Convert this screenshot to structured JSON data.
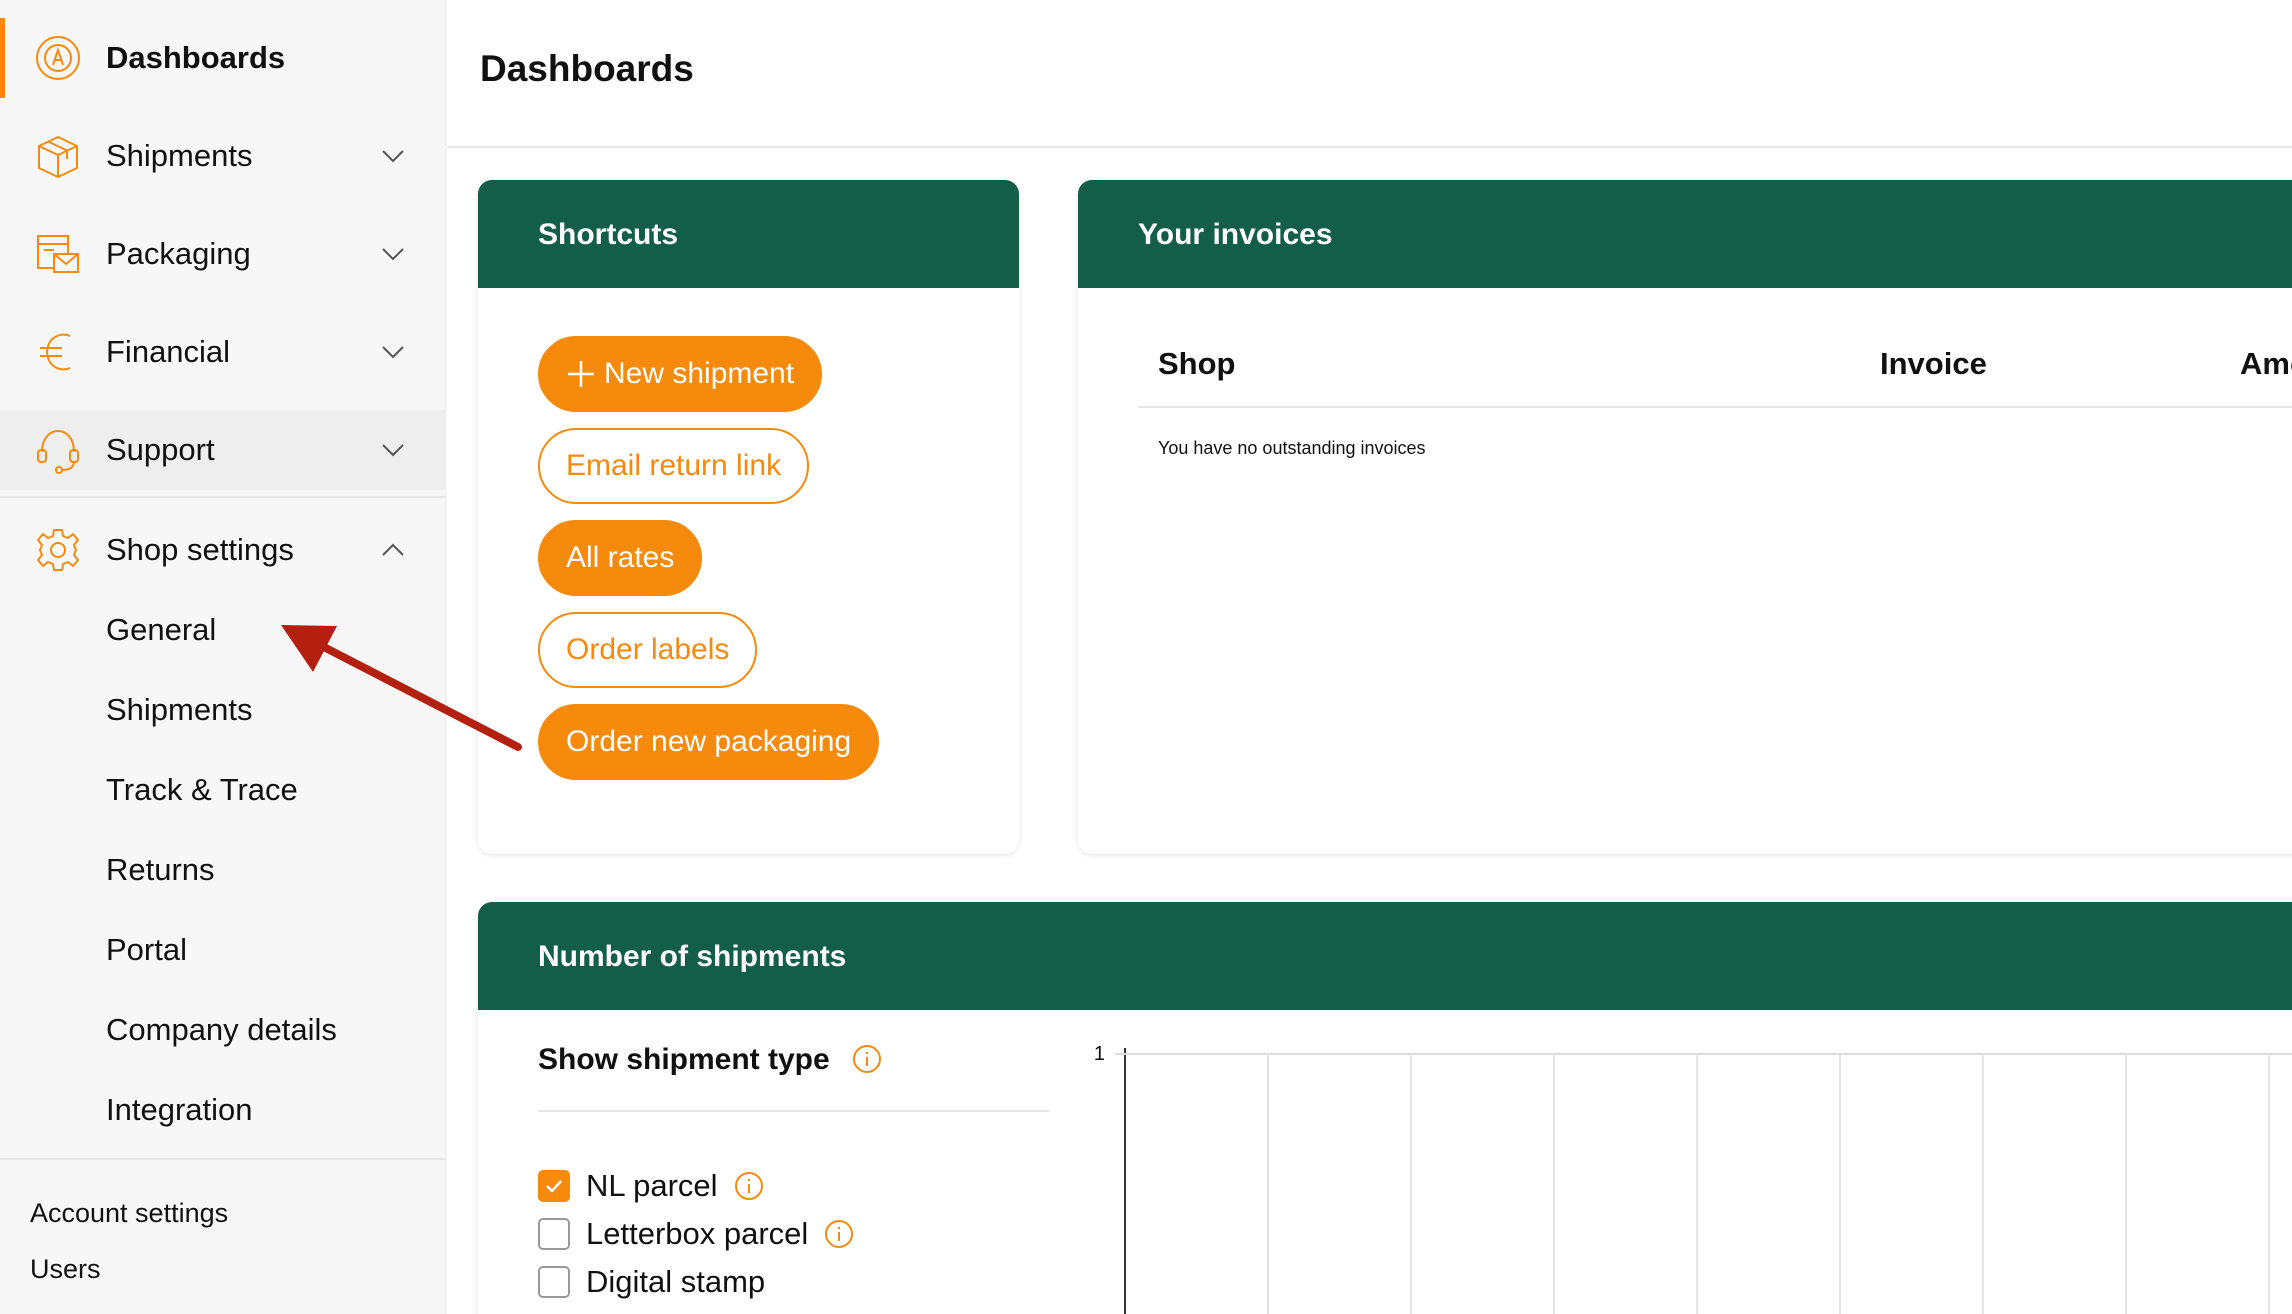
{
  "colors": {
    "accent": "#f68a0d",
    "card_header": "#135e49",
    "sidebar_bg": "#f7f7f7",
    "annotation_arrow": "#b32010"
  },
  "sidebar": {
    "items": [
      {
        "label": "Dashboards",
        "icon": "dashboard-icon",
        "active": true
      },
      {
        "label": "Shipments",
        "icon": "box-icon",
        "expandable": true
      },
      {
        "label": "Packaging",
        "icon": "packaging-icon",
        "expandable": true
      },
      {
        "label": "Financial",
        "icon": "euro-icon",
        "expandable": true
      },
      {
        "label": "Support",
        "icon": "headset-icon",
        "expandable": true
      },
      {
        "label": "Shop settings",
        "icon": "gear-icon",
        "expanded": true
      }
    ],
    "shop_settings_children": [
      "General",
      "Shipments",
      "Track & Trace",
      "Returns",
      "Portal",
      "Company details",
      "Integration"
    ],
    "bottom_links": [
      "Account settings",
      "Users"
    ]
  },
  "header": {
    "title": "Dashboards"
  },
  "shortcuts": {
    "title": "Shortcuts",
    "buttons": [
      {
        "label": "New shipment",
        "style": "filled",
        "icon": "plus-icon"
      },
      {
        "label": "Email return link",
        "style": "outline"
      },
      {
        "label": "All rates",
        "style": "filled"
      },
      {
        "label": "Order labels",
        "style": "outline"
      },
      {
        "label": "Order new packaging",
        "style": "filled"
      }
    ]
  },
  "invoices": {
    "title": "Your invoices",
    "columns": [
      "Shop",
      "Invoice",
      "Amo"
    ],
    "empty_message": "You have no outstanding invoices"
  },
  "shipments_chart": {
    "title": "Number of shipments",
    "filter_title": "Show shipment type",
    "types": [
      {
        "label": "NL parcel",
        "checked": true,
        "has_info": true
      },
      {
        "label": "Letterbox parcel",
        "checked": false,
        "has_info": true
      },
      {
        "label": "Digital stamp",
        "checked": false,
        "has_info": false
      }
    ]
  },
  "chart_data": {
    "type": "bar",
    "title": "Number of shipments",
    "yticks": [
      "1"
    ],
    "ylim": [
      0,
      1
    ],
    "grid": true,
    "categories": [],
    "series": []
  },
  "annotation": {
    "type": "arrow",
    "points_to": "General"
  }
}
